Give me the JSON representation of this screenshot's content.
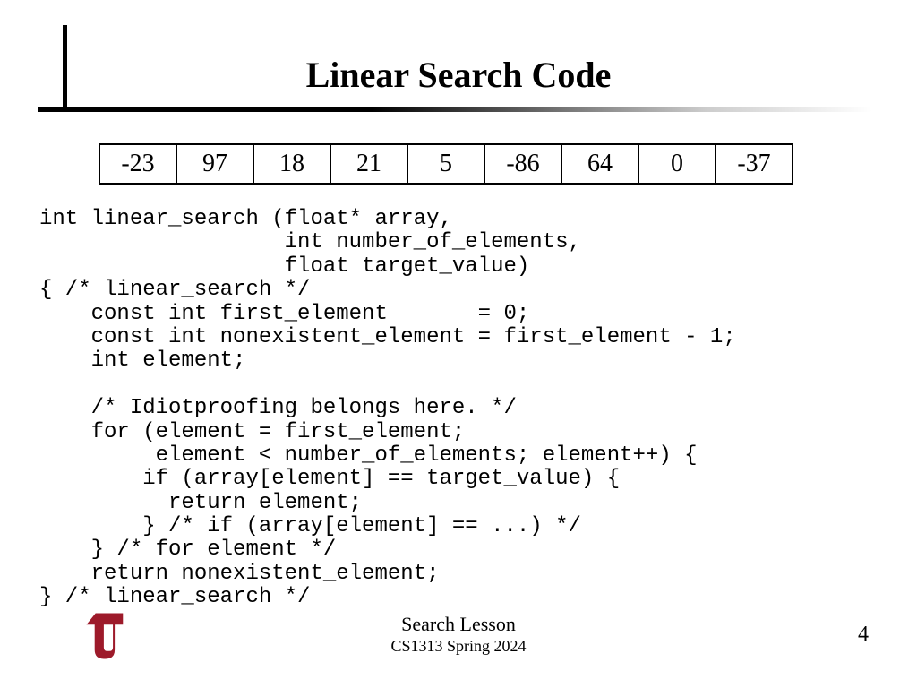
{
  "title": "Linear Search Code",
  "array": [
    "-23",
    "97",
    "18",
    "21",
    "5",
    "-86",
    "64",
    "0",
    "-37"
  ],
  "code": "int linear_search (float* array,\n                   int number_of_elements,\n                   float target_value)\n{ /* linear_search */\n    const int first_element       = 0;\n    const int nonexistent_element = first_element - 1;\n    int element;\n\n    /* Idiotproofing belongs here. */\n    for (element = first_element;\n         element < number_of_elements; element++) {\n        if (array[element] == target_value) {\n          return element;\n        } /* if (array[element] == ...) */\n    } /* for element */\n    return nonexistent_element;\n} /* linear_search */",
  "footer": {
    "lesson": "Search Lesson",
    "course": "CS1313 Spring 2024",
    "page": "4"
  },
  "logo": {
    "color": "#9d1a2a"
  }
}
